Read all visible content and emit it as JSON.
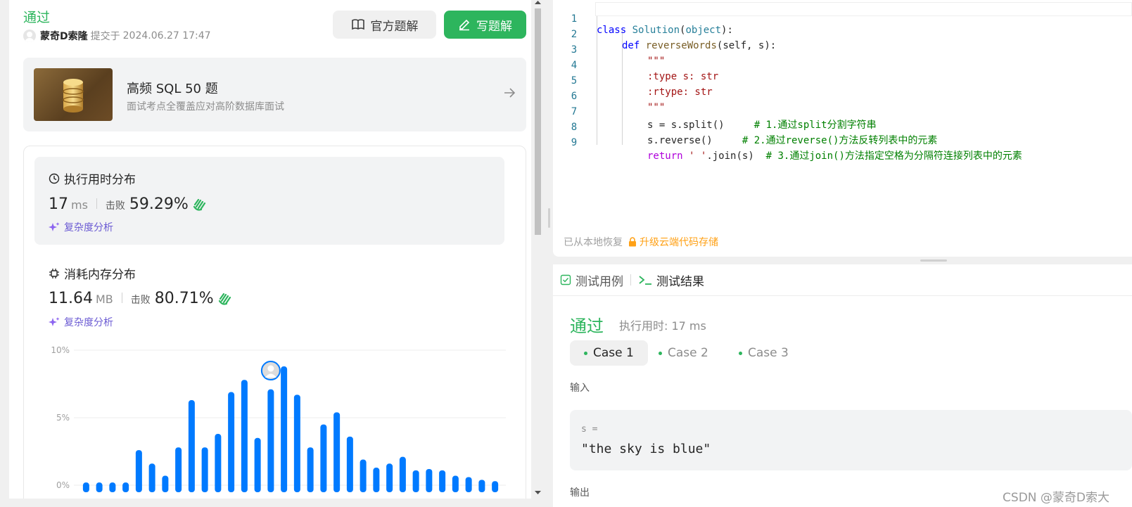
{
  "submission": {
    "status": "通过",
    "author": "蒙奇D索隆",
    "submitted_prefix": "提交于",
    "submitted_at": "2024.06.27 17:47",
    "official_solution_label": "官方题解",
    "write_solution_label": "写题解"
  },
  "study_plan": {
    "title": "高频 SQL 50 题",
    "subtitle": "面试考点全覆盖应对高阶数据库面试"
  },
  "runtime": {
    "heading": "执行用时分布",
    "value": "17",
    "unit": "ms",
    "beat_label": "击败",
    "beat_pct": "59.29%",
    "complexity_link": "复杂度分析"
  },
  "memory": {
    "heading": "消耗内存分布",
    "value": "11.64",
    "unit": "MB",
    "beat_label": "击败",
    "beat_pct": "80.71%",
    "complexity_link": "复杂度分析"
  },
  "chart_data": {
    "type": "bar",
    "title": "",
    "ylabel": "",
    "xlabel": "",
    "ylim": [
      0,
      10
    ],
    "ytick_labels": [
      "10%",
      "5%",
      "0%"
    ],
    "ytick_values": [
      10,
      5,
      0
    ],
    "bar_color": "#007aff",
    "values": [
      0.2,
      0.2,
      0.2,
      0.2,
      2.6,
      1.6,
      0.7,
      2.8,
      6.3,
      2.8,
      3.8,
      6.9,
      7.8,
      3.5,
      7.1,
      8.8,
      6.7,
      2.8,
      4.5,
      5.4,
      3.6,
      1.9,
      1.3,
      1.6,
      2.1,
      1.1,
      1.2,
      1.1,
      0.7,
      0.6,
      0.4,
      0.3
    ],
    "highlight_index": 15
  },
  "editor": {
    "lines": [
      {
        "n": "1"
      },
      {
        "n": "2"
      },
      {
        "n": "3"
      },
      {
        "n": "4"
      },
      {
        "n": "5"
      },
      {
        "n": "6"
      },
      {
        "n": "7"
      },
      {
        "n": "8"
      },
      {
        "n": "9"
      }
    ],
    "tokens": {
      "l1_kw": "class",
      "l1_name": "Solution",
      "l1_paren_open": "(",
      "l1_base": "object",
      "l1_end": "):",
      "l2_kw": "def",
      "l2_name": "reverseWords",
      "l2_args": "(self, s):",
      "l3": "\"\"\"",
      "l4": ":type s: str",
      "l5": ":rtype: str",
      "l6": "\"\"\"",
      "l7_code": "s = s.split()     ",
      "l7_comment": "# 1.通过split分割字符串",
      "l8_code": "s.reverse()     ",
      "l8_comment": "# 2.通过reverse()方法反转列表中的元素",
      "l9_kw": "return",
      "l9_str": "' '",
      "l9_code": ".join(s)  ",
      "l9_comment": "# 3.通过join()方法指定空格为分隔符连接列表中的元素"
    },
    "restore_text": "已从本地恢复",
    "upgrade_text": "升级云端代码存储"
  },
  "tests": {
    "tab_cases": "测试用例",
    "tab_results": "测试结果",
    "result_status": "通过",
    "runtime_text": "执行用时: 17 ms",
    "cases": [
      "Case 1",
      "Case 2",
      "Case 3"
    ],
    "input_label": "输入",
    "input_var": "s =",
    "input_value": "\"the sky is blue\"",
    "output_label": "输出"
  },
  "watermark": "CSDN @蒙奇D索大",
  "colors": {
    "accent_green": "#2db55d",
    "bar_blue": "#007aff",
    "link_purple": "#6b5bd3",
    "upgrade_orange": "#ffa116"
  }
}
